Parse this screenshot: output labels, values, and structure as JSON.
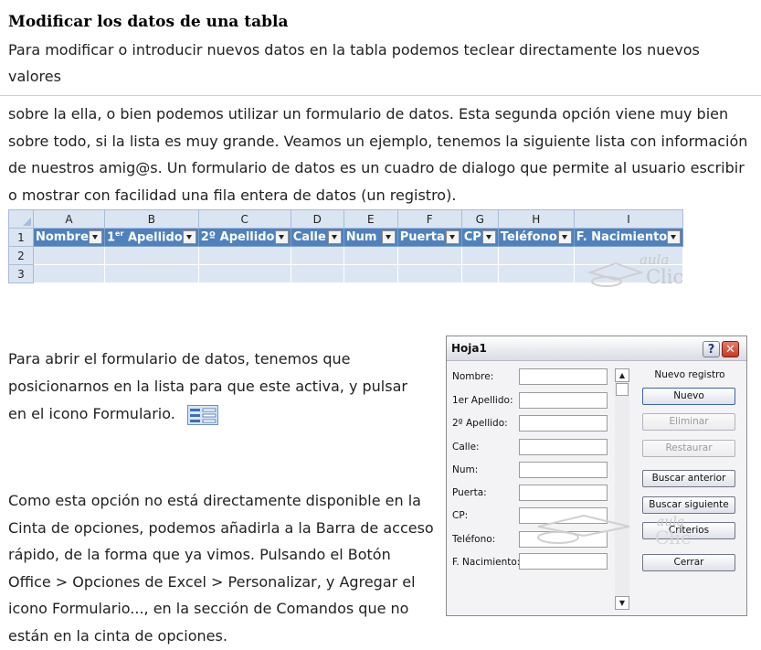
{
  "doc": {
    "title": "Modificar los datos de una tabla",
    "para1": "Para modificar o introducir nuevos datos en la tabla podemos teclear directamente los nuevos valores",
    "para2": "sobre la ella, o bien podemos utilizar un formulario de datos. Esta segunda opción viene muy bien sobre todo, si la lista es muy grande. Veamos un ejemplo, tenemos la siguiente lista con información de nuestros amig@s. Un formulario de datos es un cuadro de dialogo que permite al usuario escribir o mostrar con facilidad una fila entera de datos (un registro).",
    "para3": "Para abrir el formulario de datos, tenemos que posicionarnos en la lista para que este activa, y pulsar en el icono Formulario.",
    "para4": "Como esta opción no está directamente disponible en la Cinta de opciones, podemos añadirla a la Barra de acceso rápido, de la forma que ya vimos. Pulsando el Botón Office > Opciones de Excel > Personalizar, y Agregar el icono Formulario..., en la sección de Comandos que no están en la cinta de opciones."
  },
  "sheet": {
    "columns": [
      "A",
      "B",
      "C",
      "D",
      "E",
      "F",
      "G",
      "H",
      "I"
    ],
    "rows": [
      "1",
      "2",
      "3"
    ],
    "headers": [
      "Nombre",
      "1er Apellido",
      "2º Apellido",
      "Calle",
      "Num",
      "Puerta",
      "CP",
      "Teléfono",
      "F. Nacimiento"
    ],
    "header_sup": "er"
  },
  "watermark": {
    "text_top": "aula",
    "text_bottom": "Clic"
  },
  "dialog": {
    "title": "Hoja1",
    "help_glyph": "?",
    "close_glyph": "✕",
    "fields": [
      {
        "label": "Nombre:"
      },
      {
        "label": "1er Apellido:"
      },
      {
        "label": "2º Apellido:"
      },
      {
        "label": "Calle:"
      },
      {
        "label": "Num:"
      },
      {
        "label": "Puerta:"
      },
      {
        "label": "CP:"
      },
      {
        "label": "Teléfono:"
      },
      {
        "label": "F. Nacimiento:"
      }
    ],
    "record_status": "Nuevo registro",
    "buttons": [
      {
        "label": "Nuevo",
        "enabled": true
      },
      {
        "label": "Eliminar",
        "enabled": false
      },
      {
        "label": "Restaurar",
        "enabled": false
      },
      {
        "label": "Buscar anterior",
        "enabled": true
      },
      {
        "label": "Buscar siguiente",
        "enabled": true
      },
      {
        "label": "Criterios",
        "enabled": true
      },
      {
        "label": "Cerrar",
        "enabled": true
      }
    ],
    "scroll_up_glyph": "▲",
    "scroll_down_glyph": "▼"
  },
  "colors": {
    "header_blue": "#4f81bd",
    "data_fill": "#dce6f2",
    "grid_header": "#dbe5f1"
  },
  "icons": {
    "form_icon": "formulario-icon"
  }
}
